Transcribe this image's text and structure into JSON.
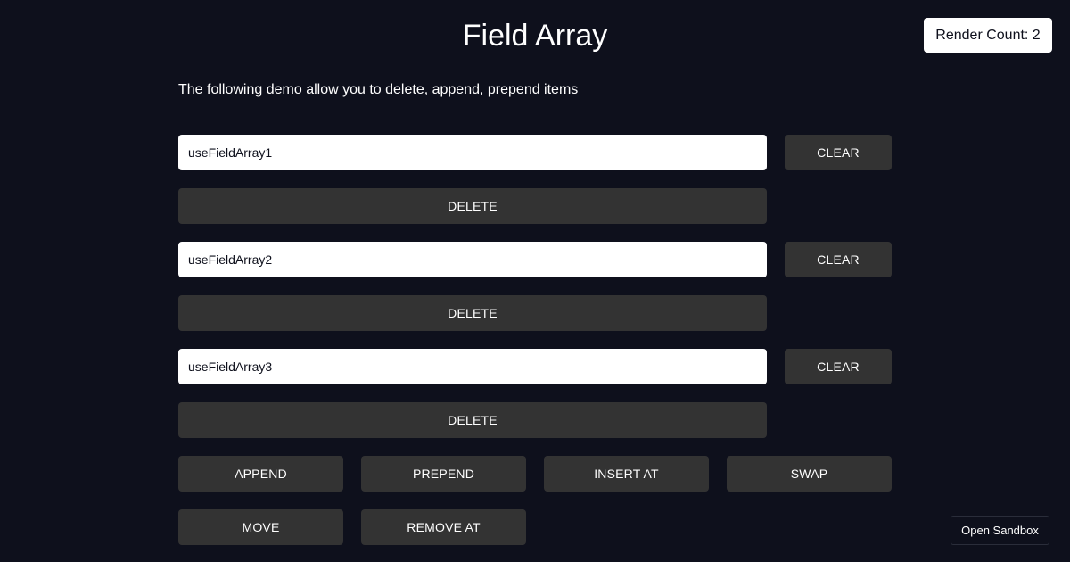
{
  "header": {
    "title": "Field Array",
    "render_count": "Render Count: 2"
  },
  "description": "The following demo allow you to delete, append, prepend items",
  "fields": [
    {
      "value": "useFieldArray1",
      "clear_label": "CLEAR",
      "delete_label": "DELETE"
    },
    {
      "value": "useFieldArray2",
      "clear_label": "CLEAR",
      "delete_label": "DELETE"
    },
    {
      "value": "useFieldArray3",
      "clear_label": "CLEAR",
      "delete_label": "DELETE"
    }
  ],
  "actions": {
    "append": "APPEND",
    "prepend": "PREPEND",
    "insert_at": "INSERT AT",
    "swap": "SWAP",
    "move": "MOVE",
    "remove_at": "REMOVE AT"
  },
  "footer": {
    "sandbox_label": "Open Sandbox"
  },
  "colors": {
    "background": "#0e101c",
    "button": "#333333",
    "divider": "#6f6fd4",
    "input": "#ffffff"
  }
}
